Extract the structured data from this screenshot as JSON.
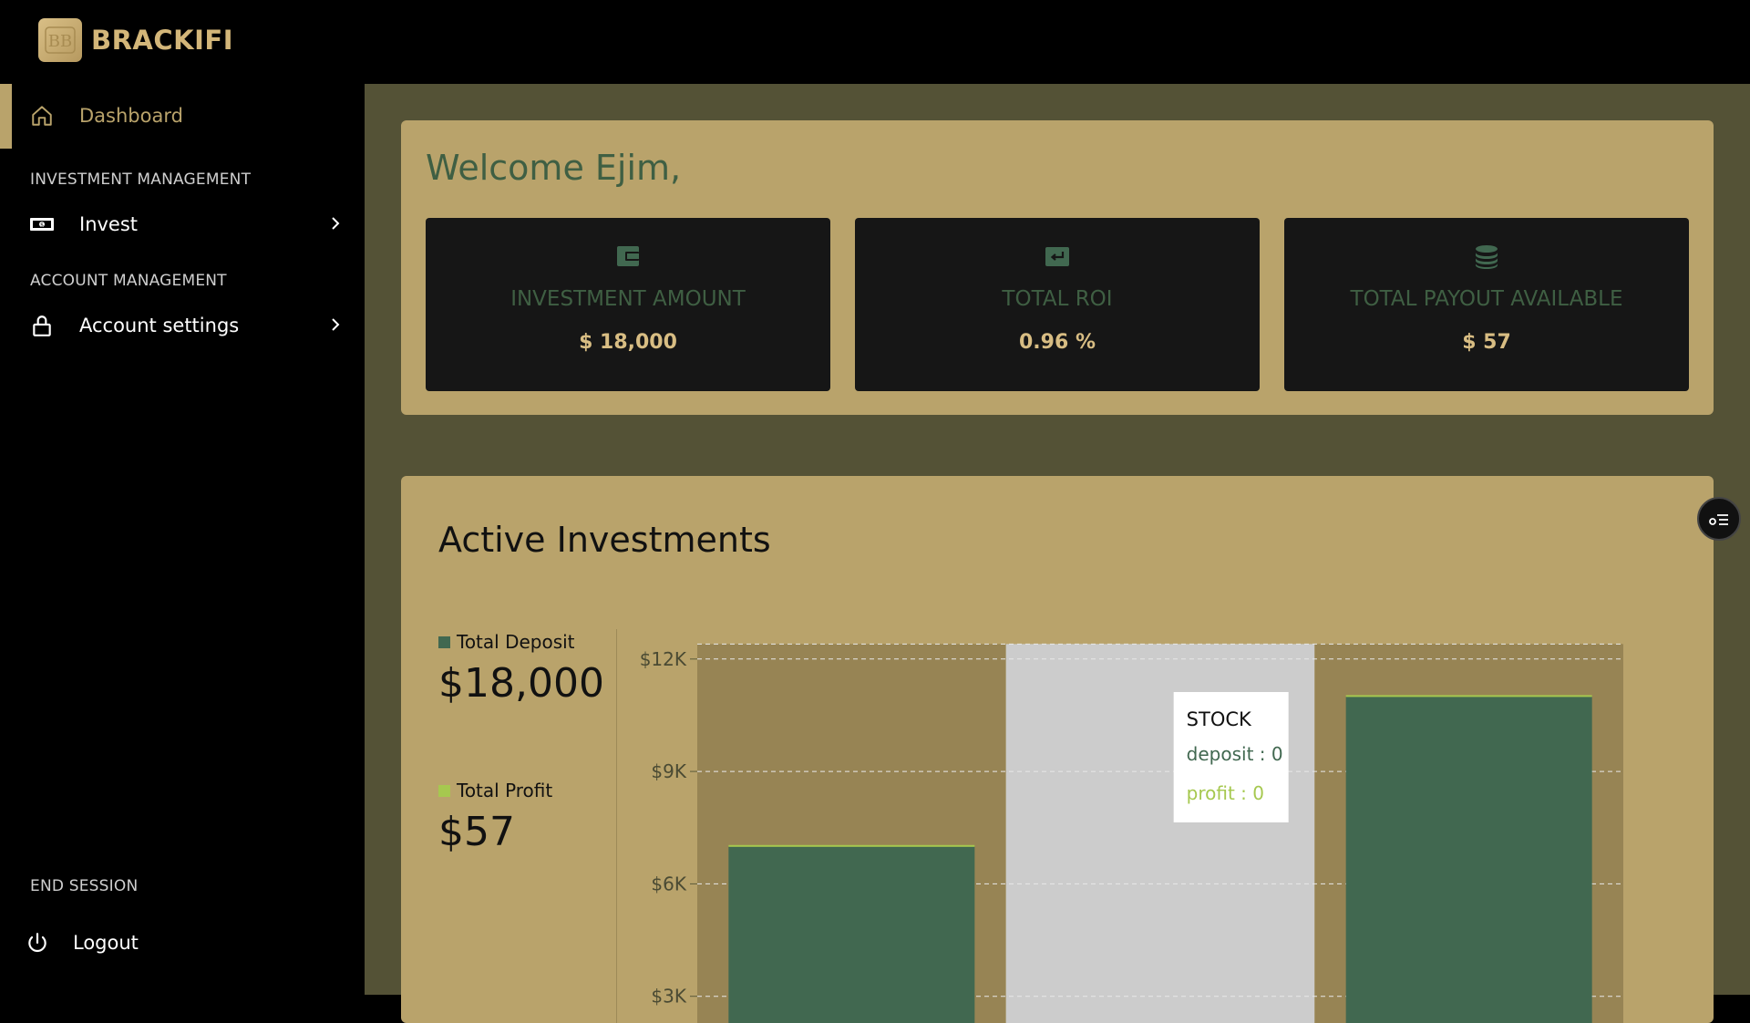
{
  "brand": {
    "name": "BRACKIFI",
    "logo_text": "BB"
  },
  "sidebar": {
    "dashboard_label": "Dashboard",
    "section_investment": "INVESTMENT MANAGEMENT",
    "invest_label": "Invest",
    "section_account": "ACCOUNT MANAGEMENT",
    "account_label": "Account settings",
    "section_end": "END SESSION",
    "logout_label": "Logout"
  },
  "welcome": {
    "title": "Welcome Ejim,"
  },
  "stats": [
    {
      "label": "INVESTMENT AMOUNT",
      "value": "$ 18,000",
      "icon": "wallet-icon"
    },
    {
      "label": "TOTAL ROI",
      "value": "0.96 %",
      "icon": "return-icon"
    },
    {
      "label": "TOTAL PAYOUT AVAILABLE",
      "value": "$ 57",
      "icon": "coins-icon"
    }
  ],
  "investments": {
    "title": "Active Investments",
    "deposit_label": "Total Deposit",
    "deposit_value": "$18,000",
    "profit_label": "Total Profit",
    "profit_value": "$57"
  },
  "tooltip": {
    "title": "STOCK",
    "deposit": "deposit : 0",
    "profit": "profit : 0"
  },
  "colors": {
    "deposit": "#416850",
    "profit": "#a6c84f",
    "gold": "#b9a36b",
    "highlight": "#cccccc"
  },
  "chart_data": {
    "type": "bar",
    "categories": [
      "",
      "STOCK",
      ""
    ],
    "series": [
      {
        "name": "deposit",
        "values": [
          7000,
          0,
          11000
        ]
      },
      {
        "name": "profit",
        "values": [
          0,
          0,
          0
        ]
      }
    ],
    "yticks": [
      "$3K",
      "$6K",
      "$9K",
      "$12K"
    ],
    "ytick_values": [
      3000,
      6000,
      9000,
      12000
    ],
    "ylim": [
      0,
      12400
    ],
    "grid": true,
    "highlight_index": 1
  }
}
